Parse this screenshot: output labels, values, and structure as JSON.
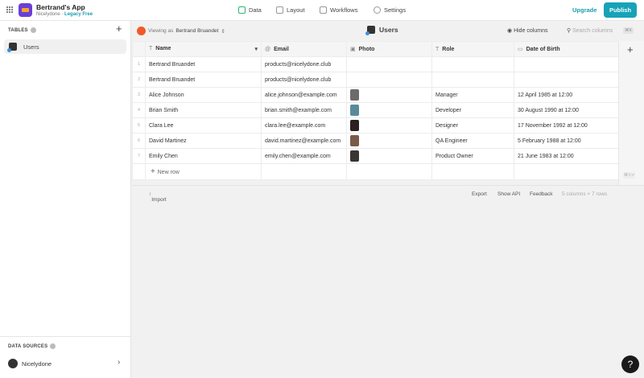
{
  "app": {
    "name": "Bertrand's App",
    "org": "Nicelydone",
    "plan": "Legacy Free"
  },
  "nav": [
    {
      "label": "Data"
    },
    {
      "label": "Layout"
    },
    {
      "label": "Workflows"
    },
    {
      "label": "Settings"
    }
  ],
  "upgrade": "Upgrade",
  "publish": "Publish",
  "sidebar": {
    "tables_label": "TABLES",
    "tables": [
      {
        "label": "Users"
      }
    ],
    "sources_label": "DATA SOURCES",
    "source": "Nicelydone"
  },
  "toolbar": {
    "viewing_prefix": "Viewing as",
    "viewing_user": "Bertrand Bruandet",
    "title": "Users",
    "hide": "Hide columns",
    "search_placeholder": "Search columns",
    "shortcut": "⌘K"
  },
  "columns": [
    "Name",
    "Email",
    "Photo",
    "Role",
    "Date of Birth"
  ],
  "rows": [
    {
      "n": "1",
      "name": "Bertrand Bruandet",
      "email": "products@nicelydone.club",
      "photo": "",
      "role": "",
      "dob": ""
    },
    {
      "n": "2",
      "name": "Bertrand Bruandet",
      "email": "products@nicelydone.club",
      "photo": "",
      "role": "",
      "dob": ""
    },
    {
      "n": "3",
      "name": "Alice Johnson",
      "email": "alice.johnson@example.com",
      "photo": "#6b6b6b",
      "role": "Manager",
      "dob": "12 April 1985 at 12:00"
    },
    {
      "n": "4",
      "name": "Brian Smith",
      "email": "brian.smith@example.com",
      "photo": "#5a8a9a",
      "role": "Developer",
      "dob": "30 August 1990 at 12:00"
    },
    {
      "n": "5",
      "name": "Clara Lee",
      "email": "clara.lee@example.com",
      "photo": "#2a2020",
      "role": "Designer",
      "dob": "17 November 1992 at 12:00"
    },
    {
      "n": "6",
      "name": "David Martinez",
      "email": "david.martinez@example.com",
      "photo": "#7a5a48",
      "role": "QA Engineer",
      "dob": "5 February 1988 at 12:00"
    },
    {
      "n": "7",
      "name": "Emily Chen",
      "email": "emily.chen@example.com",
      "photo": "#3a3535",
      "role": "Product Owner",
      "dob": "21 June 1983 at 12:00"
    }
  ],
  "new_row": "New row",
  "new_row_shortcut": "⌘⇧↵",
  "footer": {
    "import": "Import",
    "export": "Export",
    "api": "Show API",
    "feedback": "Feedback",
    "summary": "5 columns × 7 rows"
  },
  "help": "?"
}
